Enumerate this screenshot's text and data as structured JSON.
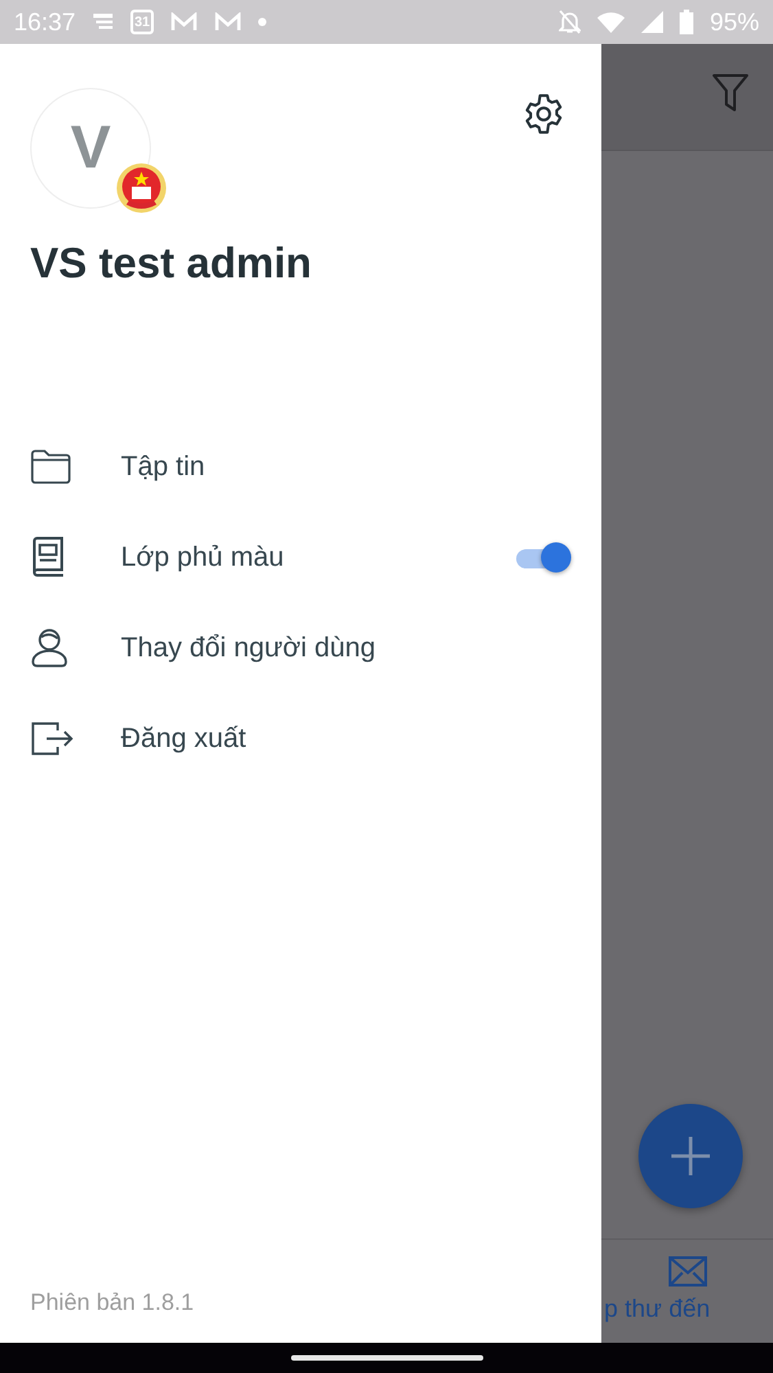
{
  "status_bar": {
    "time": "16:37",
    "calendar_day": "31",
    "battery": "95%"
  },
  "drawer": {
    "avatar_letter": "V",
    "user_name": "VS test admin",
    "menu": [
      {
        "label": "Tập tin",
        "kind": "link"
      },
      {
        "label": "Lớp phủ màu",
        "kind": "toggle",
        "on": true
      },
      {
        "label": "Thay đổi người dùng",
        "kind": "link"
      },
      {
        "label": "Đăng xuất",
        "kind": "link"
      }
    ],
    "version": "Phiên bản 1.8.1"
  },
  "background_app": {
    "bottom_tab_label": "p thư đến"
  }
}
